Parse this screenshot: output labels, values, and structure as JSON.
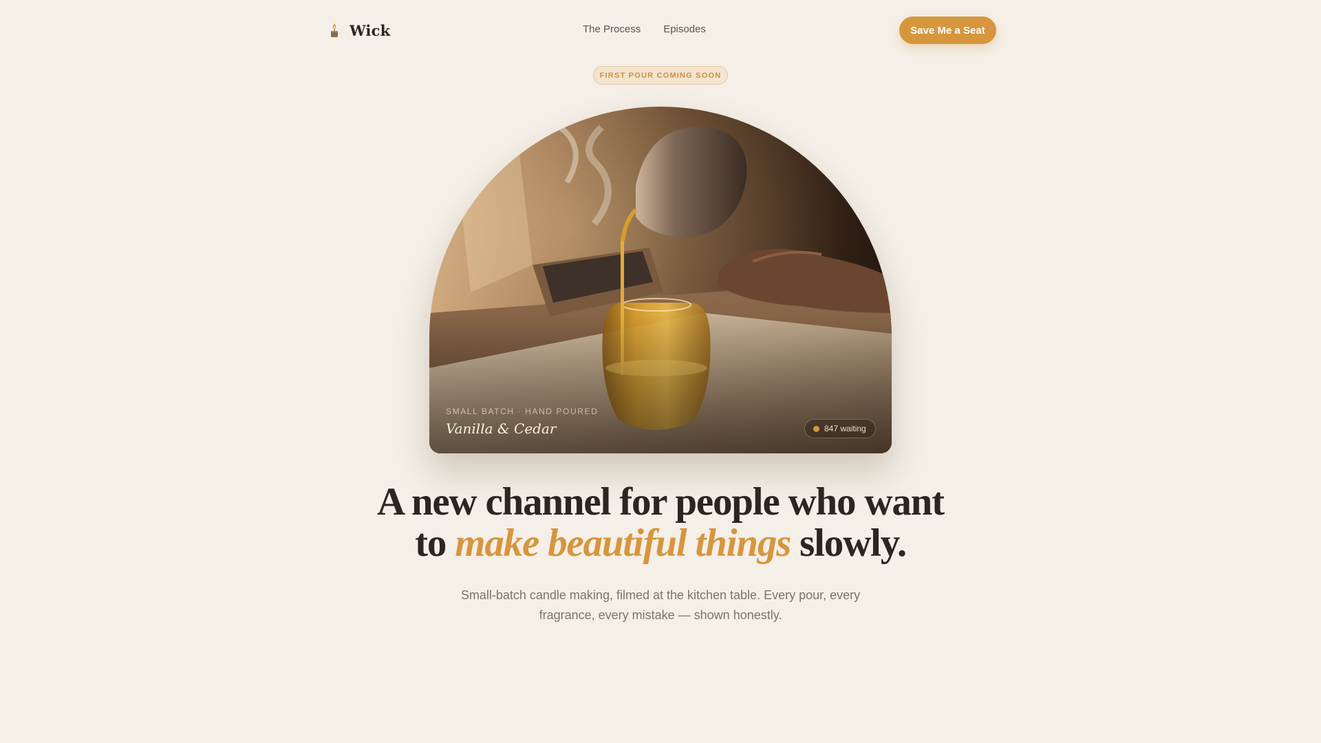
{
  "nav": {
    "brand": "Wick",
    "brand_icon": "candle-icon",
    "links": [
      "The Process",
      "Episodes"
    ],
    "cta": "Save Me a Seat"
  },
  "badge": "FIRST POUR COMING SOON",
  "hero": {
    "subtitle": "SMALL BATCH · HAND POURED",
    "title": "Vanilla & Cedar",
    "waiting_count": "847 waiting"
  },
  "headline": {
    "line1": "A new channel for people who want",
    "line2_pre": "to ",
    "line2_accent": "make beautiful things",
    "line2_post": " slowly."
  },
  "subtext": "Small-batch candle making, filmed at the kitchen table. Every pour, every fragrance, every mistake — shown honestly.",
  "colors": {
    "background": "#f4efe7",
    "accent": "#d6963e",
    "text": "#2b2621"
  }
}
